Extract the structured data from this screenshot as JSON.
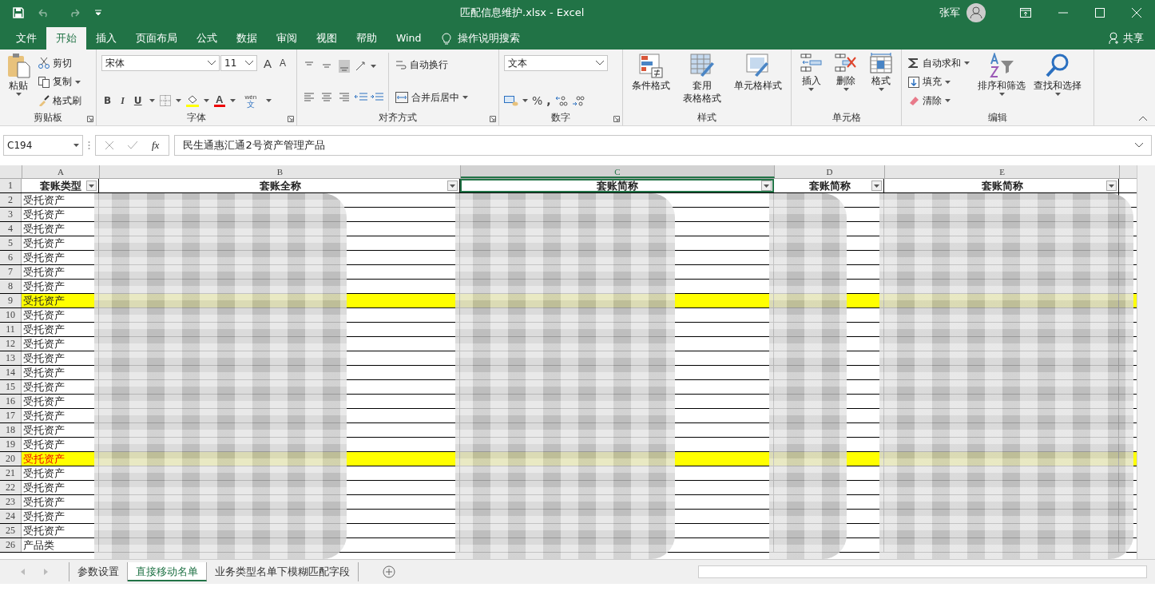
{
  "window": {
    "title": "匹配信息维护.xlsx  -  Excel",
    "user": "张军"
  },
  "ribbon_tabs": [
    {
      "label": "文件",
      "selected": false
    },
    {
      "label": "开始",
      "selected": true
    },
    {
      "label": "插入",
      "selected": false
    },
    {
      "label": "页面布局",
      "selected": false
    },
    {
      "label": "公式",
      "selected": false
    },
    {
      "label": "数据",
      "selected": false
    },
    {
      "label": "审阅",
      "selected": false
    },
    {
      "label": "视图",
      "selected": false
    },
    {
      "label": "帮助",
      "selected": false
    },
    {
      "label": "Wind",
      "selected": false
    }
  ],
  "tell_me": "操作说明搜索",
  "share": "共享",
  "clipboard": {
    "label": "剪贴板",
    "paste": "粘贴",
    "cut": "剪切",
    "copy": "复制",
    "format_painter": "格式刷"
  },
  "font": {
    "label": "字体",
    "font_name": "宋体",
    "font_size": "11",
    "grow": "A",
    "shrink": "A",
    "bold": "B",
    "italic": "I",
    "underline": "U",
    "font_color": "A",
    "phonetic_top": "wén",
    "phonetic_bottom": "文"
  },
  "alignment": {
    "label": "对齐方式",
    "wrap": "自动换行",
    "merge": "合并后居中"
  },
  "number": {
    "label": "数字",
    "format": "文本",
    "percent": "%",
    "comma": ","
  },
  "styles": {
    "label": "样式",
    "buttons": [
      {
        "lines": [
          "条件格式"
        ],
        "kind": "conditional"
      },
      {
        "lines": [
          "套用",
          "表格格式"
        ],
        "kind": "table"
      },
      {
        "lines": [
          "单元格样式"
        ],
        "kind": "cell"
      }
    ]
  },
  "cells": {
    "label": "单元格",
    "buttons": [
      {
        "label": "插入",
        "kind": "insert"
      },
      {
        "label": "删除",
        "kind": "delete"
      },
      {
        "label": "格式",
        "kind": "format"
      }
    ]
  },
  "editing": {
    "label": "编辑",
    "autosum": "自动求和",
    "fill": "填充",
    "clear": "清除",
    "sort": "排序和筛选",
    "find": "查找和选择"
  },
  "formula_bar": {
    "name_box": "C194",
    "fx": "fx",
    "value": "民生通惠汇通2号资产管理产品"
  },
  "sheet": {
    "columns": [
      {
        "letter": "A",
        "header": "套账类型",
        "selected": false
      },
      {
        "letter": "B",
        "header": "套账全称",
        "selected": false
      },
      {
        "letter": "C",
        "header": "套账简称",
        "selected": true
      },
      {
        "letter": "D",
        "header": "套账简称",
        "selected": false
      },
      {
        "letter": "E",
        "header": "套账简称",
        "selected": false
      }
    ],
    "header_row_num": "1",
    "rows": [
      {
        "num": "2",
        "type": "受托资产",
        "highlight": false,
        "red_text": false
      },
      {
        "num": "3",
        "type": "受托资产",
        "highlight": false,
        "red_text": false
      },
      {
        "num": "4",
        "type": "受托资产",
        "highlight": false,
        "red_text": false
      },
      {
        "num": "5",
        "type": "受托资产",
        "highlight": false,
        "red_text": false
      },
      {
        "num": "6",
        "type": "受托资产",
        "highlight": false,
        "red_text": false
      },
      {
        "num": "7",
        "type": "受托资产",
        "highlight": false,
        "red_text": false
      },
      {
        "num": "8",
        "type": "受托资产",
        "highlight": false,
        "red_text": false
      },
      {
        "num": "9",
        "type": "受托资产",
        "highlight": true,
        "red_text": false
      },
      {
        "num": "10",
        "type": "受托资产",
        "highlight": false,
        "red_text": false
      },
      {
        "num": "11",
        "type": "受托资产",
        "highlight": false,
        "red_text": false
      },
      {
        "num": "12",
        "type": "受托资产",
        "highlight": false,
        "red_text": false
      },
      {
        "num": "13",
        "type": "受托资产",
        "highlight": false,
        "red_text": false
      },
      {
        "num": "14",
        "type": "受托资产",
        "highlight": false,
        "red_text": false
      },
      {
        "num": "15",
        "type": "受托资产",
        "highlight": false,
        "red_text": false
      },
      {
        "num": "16",
        "type": "受托资产",
        "highlight": false,
        "red_text": false
      },
      {
        "num": "17",
        "type": "受托资产",
        "highlight": false,
        "red_text": false
      },
      {
        "num": "18",
        "type": "受托资产",
        "highlight": false,
        "red_text": false
      },
      {
        "num": "19",
        "type": "受托资产",
        "highlight": false,
        "red_text": false
      },
      {
        "num": "20",
        "type": "受托资产",
        "highlight": true,
        "red_text": true
      },
      {
        "num": "21",
        "type": "受托资产",
        "highlight": false,
        "red_text": false
      },
      {
        "num": "22",
        "type": "受托资产",
        "highlight": false,
        "red_text": false
      },
      {
        "num": "23",
        "type": "受托资产",
        "highlight": false,
        "red_text": false
      },
      {
        "num": "24",
        "type": "受托资产",
        "highlight": false,
        "red_text": false
      },
      {
        "num": "25",
        "type": "受托资产",
        "highlight": false,
        "red_text": false
      },
      {
        "num": "26",
        "type": "产品类",
        "highlight": false,
        "red_text": false
      }
    ]
  },
  "sheet_tabs": [
    {
      "label": "参数设置",
      "selected": false
    },
    {
      "label": "直接移动名单",
      "selected": true
    },
    {
      "label": "业务类型名单下模糊匹配字段",
      "selected": false
    }
  ]
}
